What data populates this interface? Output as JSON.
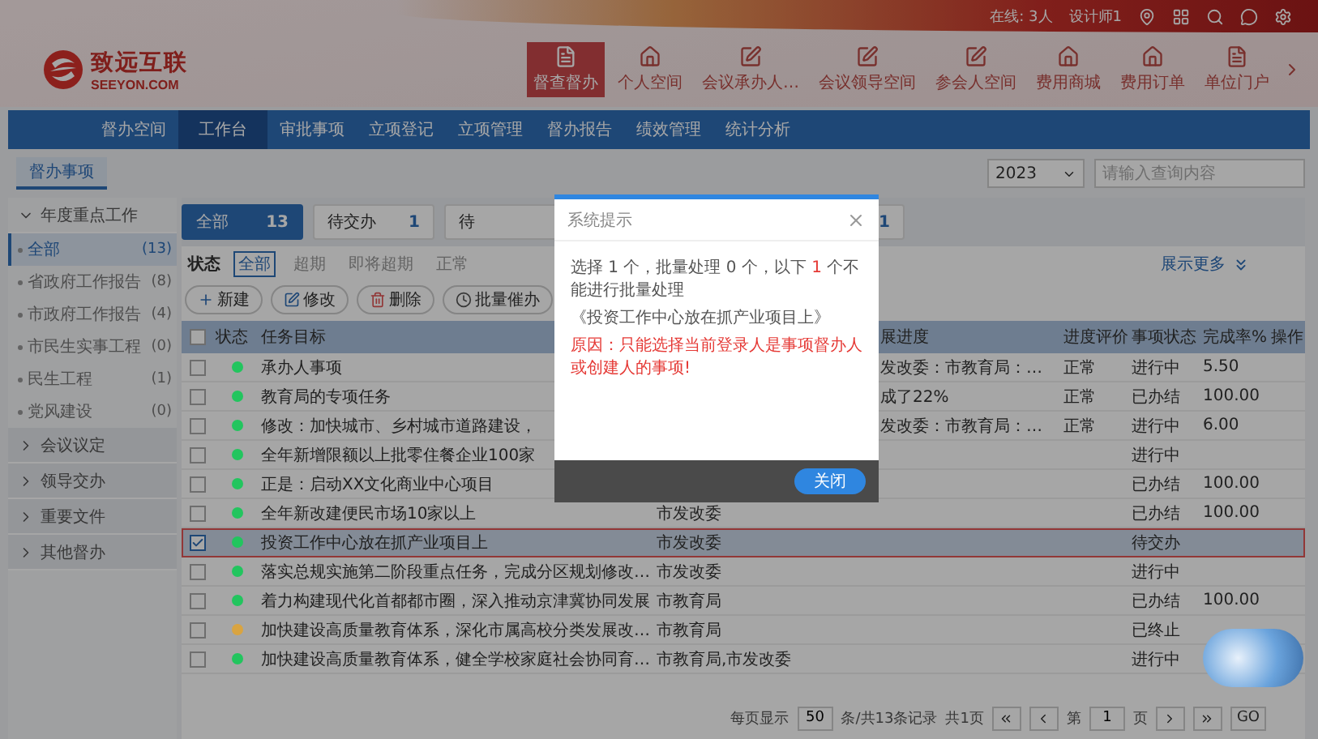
{
  "header": {
    "logo_title": "致远互联",
    "logo_subtitle": "SEEYON.COM",
    "online": "在线: 3人",
    "user": "设计师1",
    "nav": [
      {
        "label": "督查督办",
        "selected": true
      },
      {
        "label": "个人空间",
        "selected": false
      },
      {
        "label": "会议承办人…",
        "selected": false
      },
      {
        "label": "会议领导空间",
        "selected": false
      },
      {
        "label": "参会人空间",
        "selected": false
      },
      {
        "label": "费用商城",
        "selected": false
      },
      {
        "label": "费用订单",
        "selected": false
      },
      {
        "label": "单位门户",
        "selected": false
      }
    ]
  },
  "menu": [
    {
      "label": "督办空间",
      "selected": false
    },
    {
      "label": "工作台",
      "selected": true
    },
    {
      "label": "审批事项",
      "selected": false
    },
    {
      "label": "立项登记",
      "selected": false
    },
    {
      "label": "立项管理",
      "selected": false
    },
    {
      "label": "督办报告",
      "selected": false
    },
    {
      "label": "绩效管理",
      "selected": false
    },
    {
      "label": "统计分析",
      "selected": false
    }
  ],
  "page_tab": "督办事项",
  "filters": {
    "year": "2023",
    "search_placeholder": "请输入查询内容"
  },
  "sidebar": {
    "groups": [
      {
        "label": "年度重点工作",
        "expanded": true,
        "children": [
          {
            "label": "全部",
            "count": "(13)",
            "selected": true
          },
          {
            "label": "省政府工作报告",
            "count": "(8)",
            "selected": false
          },
          {
            "label": "市政府工作报告",
            "count": "(4)",
            "selected": false
          },
          {
            "label": "市民生实事工程",
            "count": "(0)",
            "selected": false
          },
          {
            "label": "民生工程",
            "count": "(1)",
            "selected": false
          },
          {
            "label": "党风建设",
            "count": "(0)",
            "selected": false
          }
        ]
      },
      {
        "label": "会议议定",
        "expanded": false
      },
      {
        "label": "领导交办",
        "expanded": false
      },
      {
        "label": "重要文件",
        "expanded": false
      },
      {
        "label": "其他督办",
        "expanded": false
      }
    ]
  },
  "tabs": [
    {
      "label": "全部",
      "count": "13",
      "selected": true
    },
    {
      "label": "待交办",
      "count": "1",
      "selected": false
    },
    {
      "label": "待",
      "selected": false
    },
    {
      "count": "1",
      "selected": false
    }
  ],
  "status_filter": {
    "label": "状态",
    "options": [
      {
        "label": "全部",
        "selected": true
      },
      {
        "label": "超期",
        "selected": false
      },
      {
        "label": "即将超期",
        "selected": false
      },
      {
        "label": "正常",
        "selected": false
      }
    ],
    "more": "展示更多"
  },
  "toolbar": [
    "新建",
    "修改",
    "删除",
    "批量催办"
  ],
  "table": {
    "select_all": {
      "checked": false
    },
    "columns": {
      "status": "状态",
      "task": "任务目标",
      "progress": "展进度",
      "evaluation": "进度评价",
      "state": "事项状态",
      "rate": "完成率%",
      "action": "操作"
    },
    "rows": [
      {
        "checked": false,
        "selected": false,
        "color": "#22c55e",
        "task": "承办人事项",
        "progress": "发改委：市教育局：…",
        "evaluation": "正常",
        "state": "进行中",
        "rate": "5.50"
      },
      {
        "checked": false,
        "selected": false,
        "color": "#22c55e",
        "task": "教育局的专项任务",
        "progress": "成了22%",
        "evaluation": "正常",
        "state": "已办结",
        "rate": "100.00"
      },
      {
        "checked": false,
        "selected": false,
        "color": "#22c55e",
        "task": "修改：加快城市、乡村城市道路建设，",
        "progress": "发改委：市教育局：…",
        "evaluation": "正常",
        "state": "进行中",
        "rate": "6.00"
      },
      {
        "checked": false,
        "selected": false,
        "color": "#22c55e",
        "task": "全年新增限额以上批零住餐企业100家",
        "state": "进行中"
      },
      {
        "checked": false,
        "selected": false,
        "color": "#22c55e",
        "task": "正是：启动XX文化商业中心项目",
        "state": "已办结",
        "rate": "100.00"
      },
      {
        "checked": false,
        "selected": false,
        "color": "#22c55e",
        "task": "全年新改建便民市场10家以上",
        "lead": "市发改委",
        "state": "已办结",
        "rate": "100.00"
      },
      {
        "checked": true,
        "selected": true,
        "color": "#22c55e",
        "task": "投资工作中心放在抓产业项目上",
        "lead": "市发改委",
        "state": "待交办"
      },
      {
        "checked": false,
        "selected": false,
        "color": "#22c55e",
        "task": "落实总规实施第二阶段重点任务，完成分区规划修改…",
        "lead": "市发改委",
        "state": "进行中"
      },
      {
        "checked": false,
        "selected": false,
        "color": "#22c55e",
        "task": "着力构建现代化首都都市圈，深入推动京津冀协同发展",
        "lead": "市教育局",
        "state": "已办结",
        "rate": "100.00"
      },
      {
        "checked": false,
        "selected": false,
        "color": "#d9a441",
        "task": "加快建设高质量教育体系，深化市属高校分类发展改…",
        "lead": "市教育局",
        "state": "已终止"
      },
      {
        "checked": false,
        "selected": false,
        "color": "#22c55e",
        "task": "加快建设高质量教育体系，健全学校家庭社会协同育…",
        "lead": "市教育局,市发改委",
        "state": "进行中"
      }
    ]
  },
  "pagination": {
    "per_page_label": "每页显示",
    "per_page": "50",
    "total": "条/共13条记录",
    "pages": "共1页",
    "page_prefix": "第",
    "page": "1",
    "page_suffix": "页",
    "go": "GO"
  },
  "dialog": {
    "title": "系统提示",
    "message": [
      {
        "text": "选择 1 个，批量处理 0 个，以下 ",
        "kind": "plain"
      },
      {
        "text": "1",
        "kind": "alert"
      },
      {
        "text": " 个不能进行批量处理",
        "kind": "plain"
      }
    ],
    "item": "《投资工作中心放在抓产业项目上》",
    "reason": "原因：只能选择当前登录人是事项督办人或创建人的事项!",
    "button": "关闭"
  }
}
